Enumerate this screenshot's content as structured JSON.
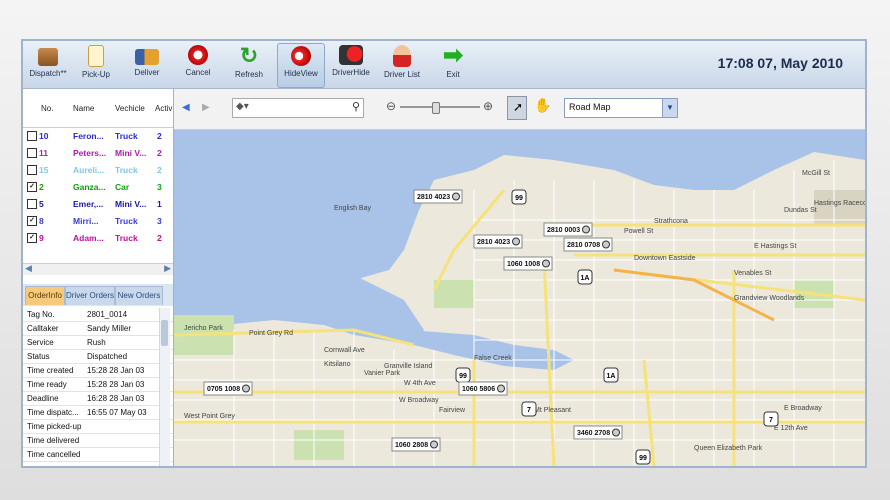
{
  "toolbar": {
    "buttons": [
      {
        "label": "Dispatch**",
        "icon": "dispatch-icon"
      },
      {
        "label": "Pick-Up",
        "icon": "pickup-icon"
      },
      {
        "label": "Deliver",
        "icon": "deliver-icon"
      },
      {
        "label": "Cancel",
        "icon": "cancel-icon"
      },
      {
        "label": "Refresh",
        "icon": "refresh-icon"
      },
      {
        "label": "HideView",
        "icon": "hideview-icon"
      },
      {
        "label": "DriverHide",
        "icon": "driverhide-icon"
      },
      {
        "label": "Driver List",
        "icon": "driverlist-icon"
      },
      {
        "label": "Exit",
        "icon": "exit-icon"
      }
    ],
    "clock": "17:08   07, May 2010"
  },
  "vehicles": {
    "headers": [
      "No.",
      "Name",
      "Vechicle",
      "Activ"
    ],
    "rows": [
      {
        "no": "10",
        "name": "Feron...",
        "vehicle": "Truck",
        "active": "2",
        "color": "#2a2ad8",
        "checked": false
      },
      {
        "no": "11",
        "name": "Peters...",
        "vehicle": "Mini V...",
        "active": "2",
        "color": "#b01ab0",
        "checked": false
      },
      {
        "no": "15",
        "name": "Aureli...",
        "vehicle": "Truck",
        "active": "2",
        "color": "#7cc8e8",
        "checked": false
      },
      {
        "no": "2",
        "name": "Ganza...",
        "vehicle": "Car",
        "active": "3",
        "color": "#10a010",
        "checked": true
      },
      {
        "no": "5",
        "name": "Emer,...",
        "vehicle": "Mini V...",
        "active": "1",
        "color": "#1818a0",
        "checked": false
      },
      {
        "no": "8",
        "name": "Mirri...",
        "vehicle": "Truck",
        "active": "3",
        "color": "#3a3ad8",
        "checked": true
      },
      {
        "no": "9",
        "name": "Adam...",
        "vehicle": "Truck",
        "active": "2",
        "color": "#c0109a",
        "checked": true
      }
    ]
  },
  "tabs": [
    "OrderInfo",
    "Driver Orders",
    "New Orders"
  ],
  "order_info": [
    {
      "label": "Tag No.",
      "value": "2801_0014"
    },
    {
      "label": "Calltaker",
      "value": "Sandy Miller"
    },
    {
      "label": "Service",
      "value": "Rush"
    },
    {
      "label": "Status",
      "value": "Dispatched"
    },
    {
      "label": "Time created",
      "value": "15:28 28 Jan 03"
    },
    {
      "label": "Time ready",
      "value": "15:28 28 Jan 03"
    },
    {
      "label": "Deadline",
      "value": "16:28 28 Jan 03"
    },
    {
      "label": "Time dispatc...",
      "value": "16:55 07 May 03"
    },
    {
      "label": "Time picked-up",
      "value": ""
    },
    {
      "label": "Time delivered",
      "value": ""
    },
    {
      "label": "Time cancelled",
      "value": ""
    }
  ],
  "map_toolbar": {
    "search_placeholder": "",
    "map_type": "Road Map"
  },
  "map": {
    "place_labels": [
      "English Bay",
      "False Creek",
      "Kitsilano",
      "Point Grey Rd",
      "Cornwall Ave",
      "W 4th Ave",
      "W Broadway",
      "Fairview",
      "Mt Pleasant",
      "Strathcona",
      "Downtown Eastside",
      "Grandview Woodlands",
      "Jericho Park",
      "West Point Grey",
      "McGill St",
      "Hastings Racecourse",
      "E Hastings St",
      "Powell St",
      "Venables St",
      "Dundas St",
      "E 12th Ave",
      "E Broadway",
      "Granville Island",
      "Vanier Park",
      "Queen Elizabeth Park"
    ],
    "markers": [
      "2810 4023",
      "2810 4023",
      "2810 0003",
      "2810 0708",
      "1060 1008",
      "0705 1008",
      "1060 5806",
      "3460 2708",
      "1060 2808"
    ],
    "shields": [
      "99",
      "1A",
      "99",
      "7",
      "1A",
      "7",
      "99"
    ]
  }
}
